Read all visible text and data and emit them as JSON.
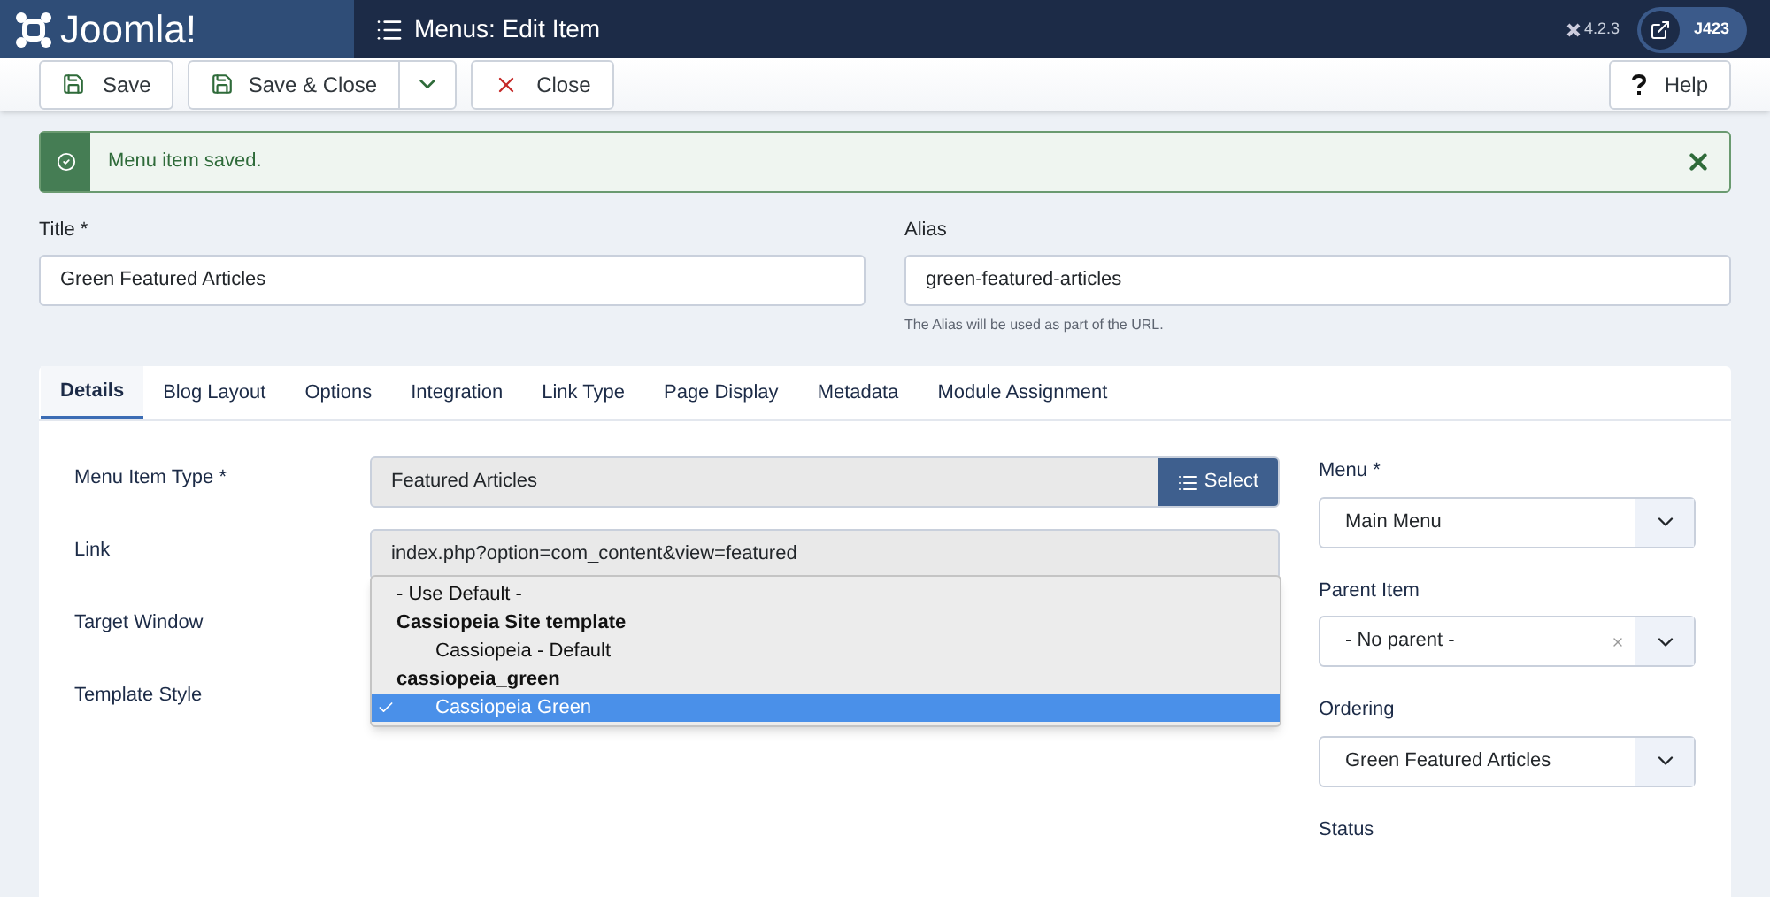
{
  "header": {
    "logo": "Joomla!",
    "title": "Menus: Edit Item",
    "version": "4.2.3",
    "user": "J423"
  },
  "toolbar": {
    "buttons": [
      {
        "kind": "save",
        "label": "Save"
      },
      {
        "kind": "save-close",
        "label": "Save & Close"
      },
      {
        "kind": "close",
        "label": "Close"
      }
    ],
    "help": "Help"
  },
  "alert": {
    "message": "Menu item saved."
  },
  "title": {
    "label": "Title *",
    "value": "Green Featured Articles"
  },
  "alias": {
    "label": "Alias",
    "value": "green-featured-articles",
    "help": "The Alias will be used as part of the URL."
  },
  "tabs": [
    {
      "label": "Details",
      "selected": true
    },
    {
      "label": "Blog Layout",
      "selected": false
    },
    {
      "label": "Options",
      "selected": false
    },
    {
      "label": "Integration",
      "selected": false
    },
    {
      "label": "Link Type",
      "selected": false
    },
    {
      "label": "Page Display",
      "selected": false
    },
    {
      "label": "Metadata",
      "selected": false
    },
    {
      "label": "Module Assignment",
      "selected": false
    }
  ],
  "fields": [
    {
      "label": "Menu Item Type *",
      "value": "Featured Articles",
      "button": "Select"
    },
    {
      "label": "Link",
      "value": "index.php?option=com_content&view=featured"
    },
    {
      "label": "Target Window"
    },
    {
      "label": "Template Style"
    }
  ],
  "dropdown": [
    {
      "kind": "option",
      "label": "- Use Default -",
      "indent": false,
      "selected": false
    },
    {
      "kind": "group",
      "label": "Cassiopeia Site template"
    },
    {
      "kind": "option",
      "label": "Cassiopeia - Default",
      "indent": true,
      "selected": false
    },
    {
      "kind": "group",
      "label": "cassiopeia_green"
    },
    {
      "kind": "option",
      "label": "Cassiopeia Green",
      "indent": true,
      "selected": true
    }
  ],
  "side": [
    {
      "label": "Menu *",
      "value": "Main Menu",
      "clearable": false
    },
    {
      "label": "Parent Item",
      "value": "- No parent -",
      "clearable": true
    },
    {
      "label": "Ordering",
      "value": "Green Featured Articles",
      "clearable": false
    }
  ],
  "status": {
    "label": "Status"
  }
}
